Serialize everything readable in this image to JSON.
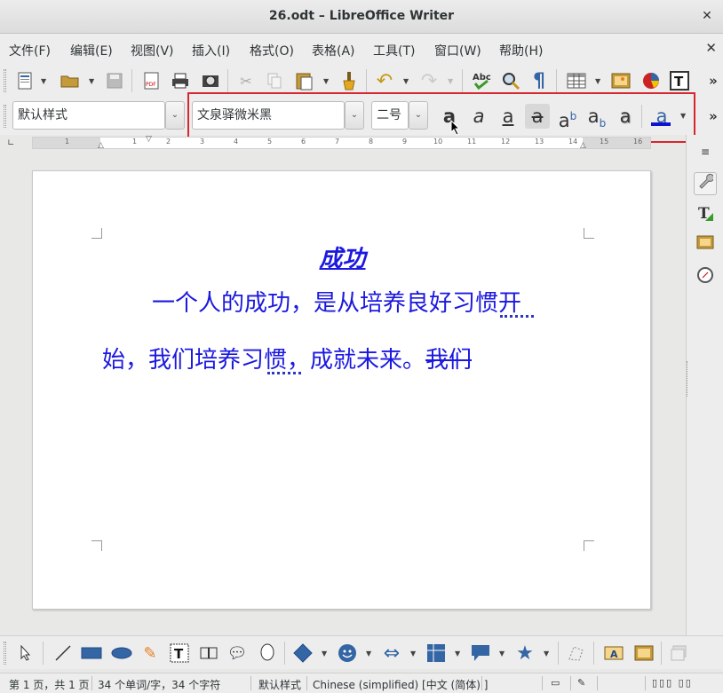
{
  "window": {
    "title": "26.odt – LibreOffice Writer",
    "close_glyph": "✕"
  },
  "menu": {
    "items": [
      "文件(F)",
      "编辑(E)",
      "视图(V)",
      "插入(I)",
      "格式(O)",
      "表格(A)",
      "工具(T)",
      "窗口(W)",
      "帮助(H)"
    ],
    "close_glyph": "✕"
  },
  "formatting": {
    "paragraph_style": "默认样式",
    "font_name": "文泉驿微米黑",
    "font_size": "二号",
    "combo_arrow": "⌄",
    "overflow": "»"
  },
  "ruler": {
    "ticks": [
      "1",
      "1",
      "2",
      "3",
      "4",
      "5",
      "6",
      "7",
      "8",
      "9",
      "10",
      "11",
      "12",
      "13",
      "14",
      "15",
      "16"
    ]
  },
  "document": {
    "title": "成功",
    "line1": "一个人的成功，是从培养良好习惯开",
    "line2_plain": "始，我们培养习惯，成就未来。",
    "line2_strike": "我们"
  },
  "status": {
    "page": "第 1 页，共 1 页",
    "words": "34 个单词/字，34 个字符",
    "style": "默认样式",
    "language": "Chinese (simplified) [中文 (简体) ]"
  },
  "colors": {
    "text_blue": "#1b18e0",
    "highlight_red": "#d8262e",
    "font_color_bar": "#1010d0"
  }
}
